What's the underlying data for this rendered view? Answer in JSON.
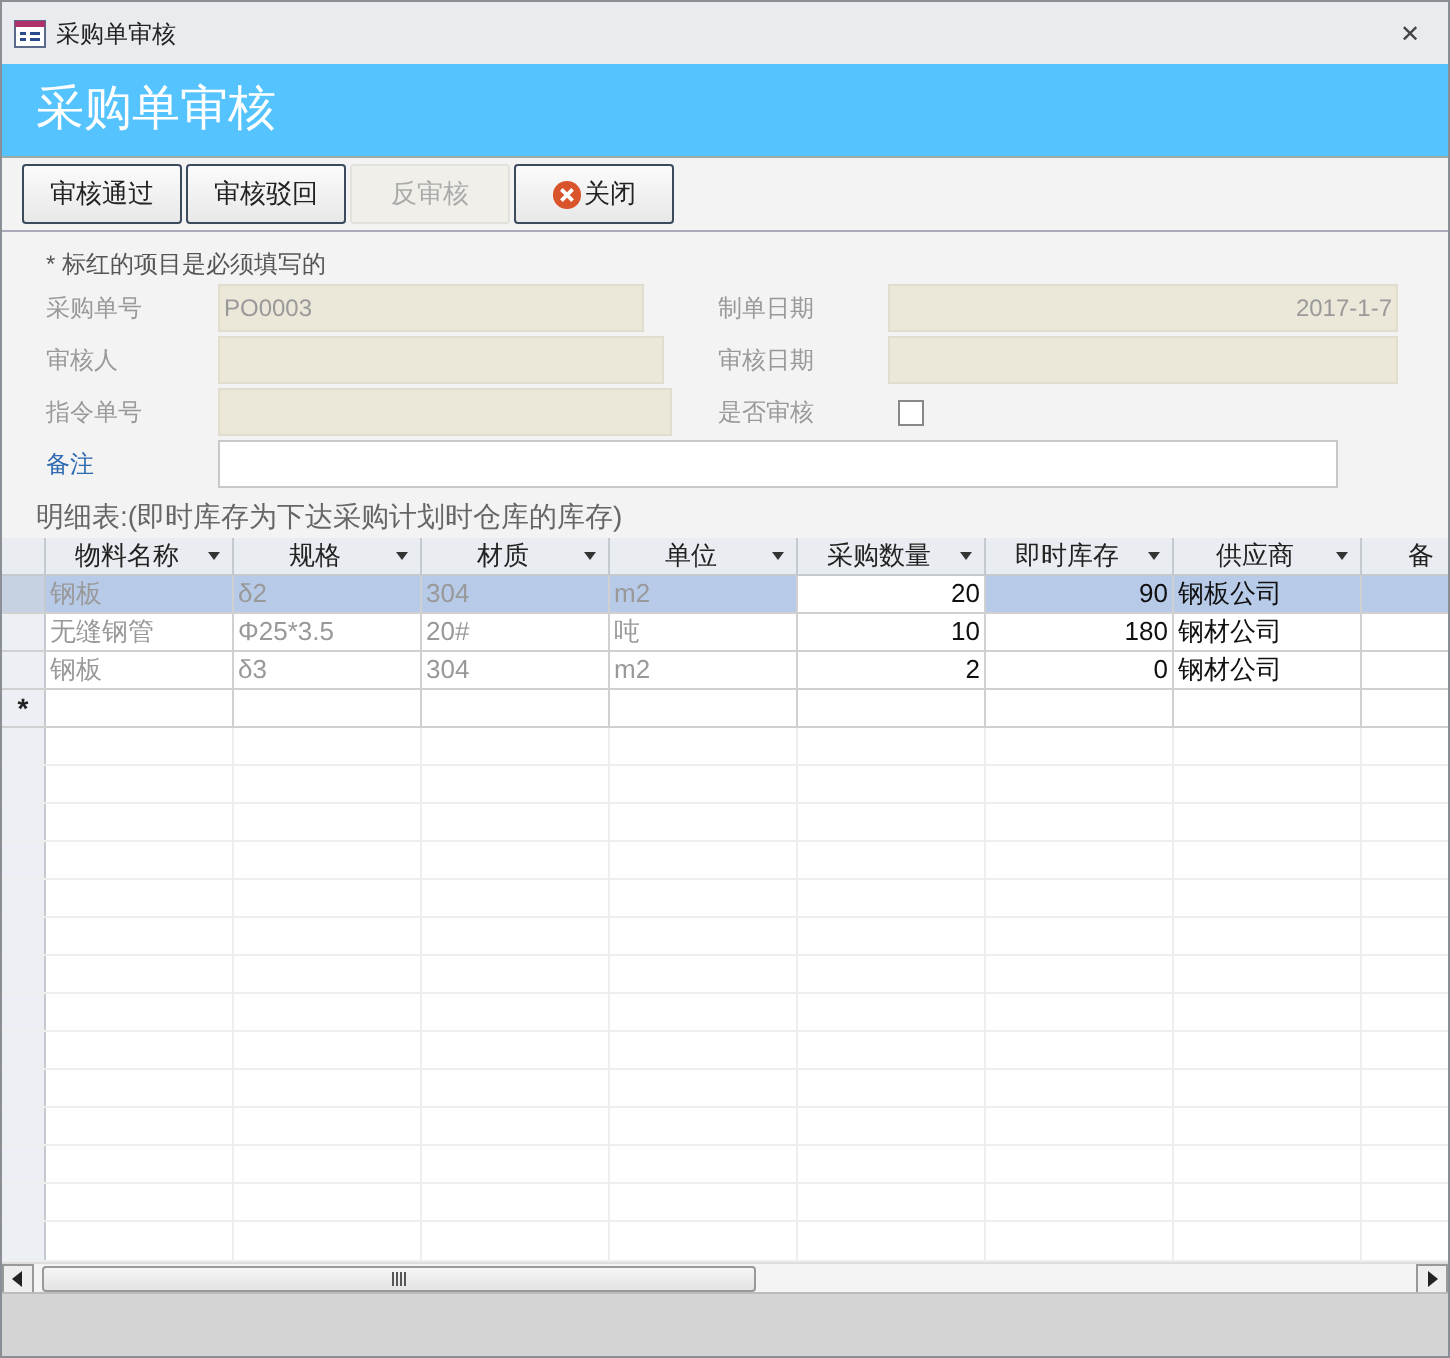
{
  "window": {
    "title": "采购单审核",
    "close": "✕"
  },
  "header": {
    "title": "采购单审核"
  },
  "toolbar": [
    {
      "label": "审核通过",
      "kind": "plain",
      "disabled": false
    },
    {
      "label": "审核驳回",
      "kind": "plain",
      "disabled": false
    },
    {
      "label": "反审核",
      "kind": "plain",
      "disabled": true
    },
    {
      "label": "关闭",
      "kind": "close",
      "disabled": false
    }
  ],
  "note": "* 标红的项目是必须填写的",
  "form": [
    [
      {
        "label": "采购单号",
        "kind": "locked",
        "value": "PO0003"
      },
      {
        "label": "制单日期",
        "kind": "locked",
        "value": "2017-1-7"
      }
    ],
    [
      {
        "label": "审核人",
        "kind": "locked"
      },
      {
        "label": "审核日期",
        "kind": "locked"
      }
    ],
    [
      {
        "label": "指令单号",
        "kind": "locked"
      },
      {
        "label": "是否审核",
        "kind": "checkbox",
        "checked": false
      }
    ],
    [
      {
        "label": "备注",
        "kind": "text"
      }
    ]
  ],
  "detail_caption": "明细表:(即时库存为下达采购计划时仓库的库存)",
  "table": {
    "columns": [
      {
        "label": "物料名称"
      },
      {
        "label": "规格"
      },
      {
        "label": "材质"
      },
      {
        "label": "单位"
      },
      {
        "label": "采购数量"
      },
      {
        "label": "即时库存"
      },
      {
        "label": "供应商"
      },
      {
        "label": "备"
      }
    ],
    "rows": [
      {
        "selected": true,
        "cells": [
          "钢板",
          "δ2",
          "304",
          "m2",
          "20",
          "90",
          "钢板公司"
        ]
      },
      {
        "selected": false,
        "cells": [
          "无缝钢管",
          "Φ25*3.5",
          "20#",
          "吨",
          "10",
          "180",
          "钢材公司"
        ]
      },
      {
        "selected": false,
        "cells": [
          "钢板",
          "δ3",
          "304",
          "m2",
          "2",
          "0",
          "钢材公司"
        ]
      }
    ],
    "new_row_marker": "*"
  }
}
